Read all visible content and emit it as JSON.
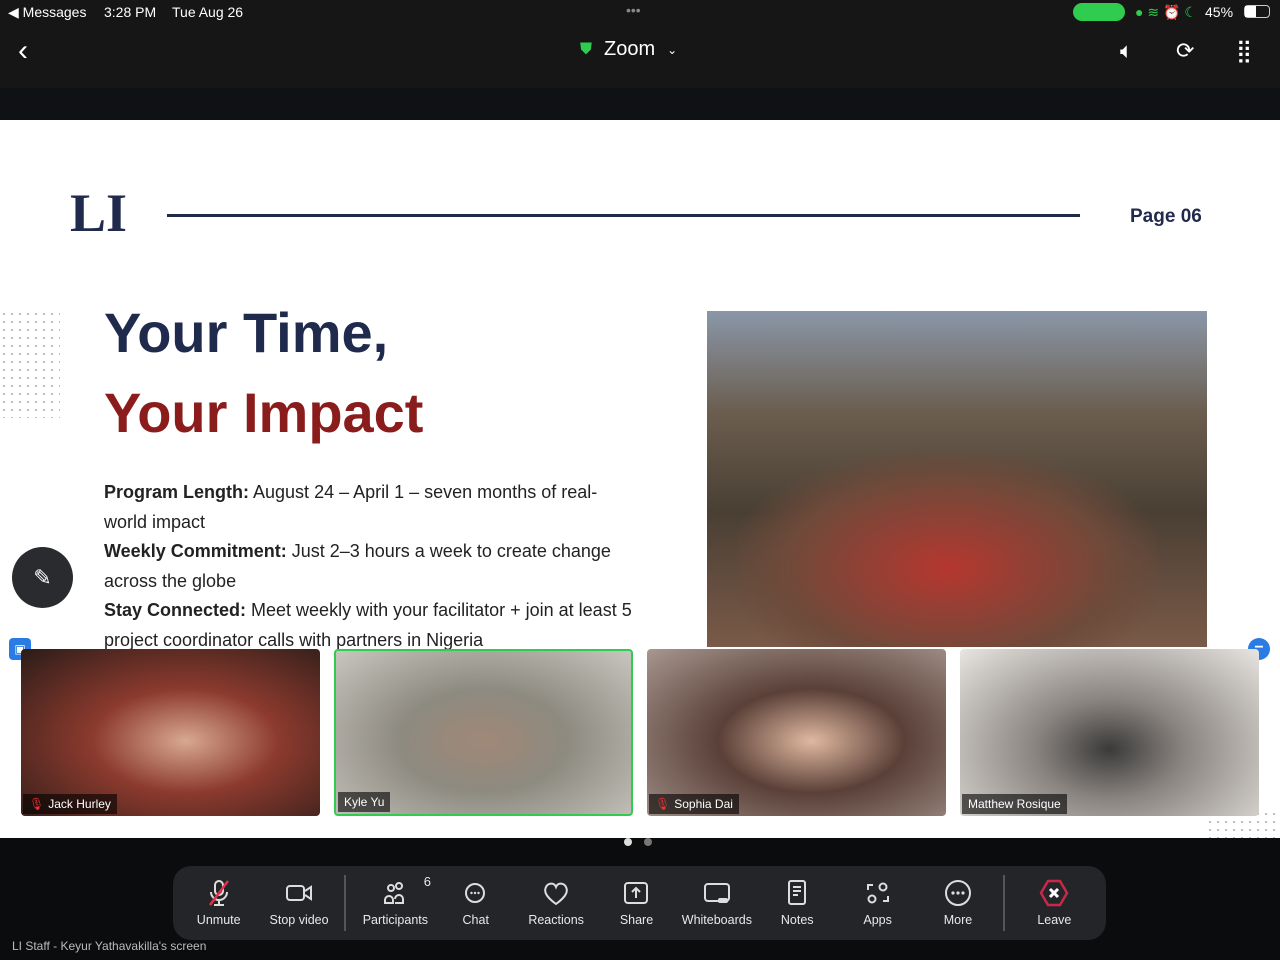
{
  "status": {
    "back_app": "Messages",
    "time": "3:28 PM",
    "date": "Tue Aug 26",
    "battery": "45%"
  },
  "nav": {
    "title": "Zoom"
  },
  "slide": {
    "page": "Page 06",
    "title_line1": "Your Time,",
    "title_line2": "Your Impact",
    "items": [
      {
        "label": "Program Length:",
        "text": " August 24 – April 1 – seven months of real-world impact"
      },
      {
        "label": "Weekly Commitment:",
        "text": " Just 2–3 hours a week to create change across the globe"
      },
      {
        "label": "Stay Connected:",
        "text": " Meet weekly with your facilitator + join at least 5 project coordinator calls with partners in Nigeria"
      }
    ]
  },
  "participants": [
    {
      "name": "Jack Hurley",
      "muted": true
    },
    {
      "name": "Kyle Yu",
      "muted": false,
      "active": true
    },
    {
      "name": "Sophia Dai",
      "muted": true
    },
    {
      "name": "Matthew Rosique",
      "muted": false
    }
  ],
  "toolbar": {
    "unmute": "Unmute",
    "stop_video": "Stop video",
    "participants": "Participants",
    "participants_count": "6",
    "chat": "Chat",
    "reactions": "Reactions",
    "share": "Share",
    "whiteboards": "Whiteboards",
    "notes": "Notes",
    "apps": "Apps",
    "more": "More",
    "leave": "Leave"
  },
  "footer": {
    "screen_label": "LI Staff - Keyur Yathavakilla's screen"
  },
  "colors": {
    "accent_green": "#2fcc4f",
    "leave_red": "#c8284a",
    "navy": "#1f2a4d",
    "dark_red": "#8a1c1c"
  }
}
